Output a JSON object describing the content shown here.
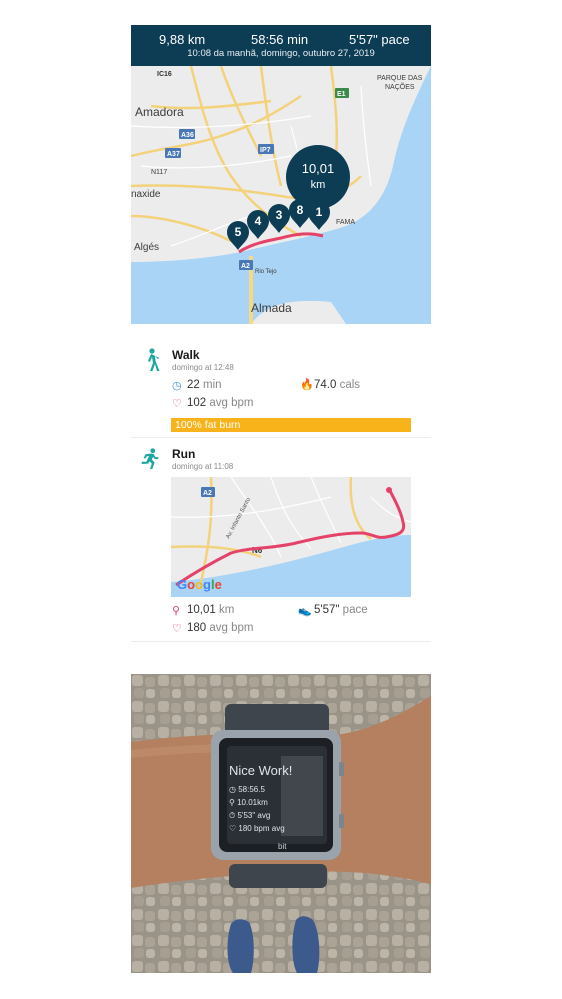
{
  "summary": {
    "distance": "9,88 km",
    "duration": "58:56 min",
    "pace": "5'57\" pace",
    "datetime": "10:08 da manhã, domingo, outubro 27, 2019"
  },
  "map1": {
    "places": [
      "Amadora",
      "Almada",
      "naxide",
      "Algés",
      "PARQUE DAS",
      "NAÇÕES",
      "Rio Tejo",
      "FAMA",
      "N117"
    ],
    "roads": [
      "IC16",
      "A36",
      "A37",
      "IP7",
      "E1",
      "A2"
    ],
    "total_marker": {
      "line1": "10,01",
      "line2": "km"
    },
    "km_markers": [
      "5",
      "4",
      "3",
      "8",
      "1"
    ]
  },
  "walk": {
    "icon": "walking-person-icon",
    "title": "Walk",
    "time": "domingo at 12:48",
    "duration_value": "22",
    "duration_unit": "min",
    "cals_value": "74.0",
    "cals_unit": "cals",
    "bpm_value": "102",
    "bpm_unit": "avg bpm",
    "zone_label": "100% fat burn",
    "zone_color": "#f9b31a"
  },
  "run": {
    "icon": "running-person-icon",
    "title": "Run",
    "time": "domingo at 11:08",
    "distance_value": "10,01",
    "distance_unit": "km",
    "pace_value": "5'57\"",
    "pace_unit": "pace",
    "bpm_value": "180",
    "bpm_unit": "avg bpm",
    "map_roads": [
      "A2",
      "N6"
    ],
    "map_street": "Av. Infante Santo",
    "map_logo": "Google"
  },
  "watch": {
    "headline": "Nice Work!",
    "time": "58:56.5",
    "distance": "10.01km",
    "pace": "5'53\" avg",
    "bpm": "180 bpm avg",
    "brand": "bit"
  },
  "colors": {
    "header_bg": "#0d3c55",
    "route": "#e5426a",
    "teal_icon": "#1ba6a0",
    "water": "#a9d4f5"
  }
}
